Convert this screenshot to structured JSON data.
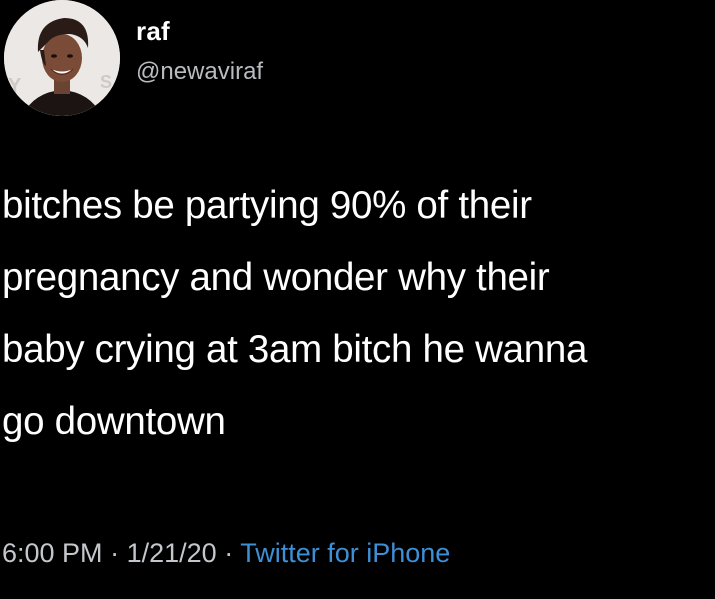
{
  "user": {
    "display_name": "raf",
    "handle": "@newaviraf"
  },
  "tweet": {
    "lines": [
      "bitches be partying 90% of their",
      "pregnancy and wonder why their",
      "baby crying at 3am bitch he wanna",
      "go downtown"
    ]
  },
  "meta": {
    "time": "6:00 PM",
    "separator": "·",
    "date": "1/21/20",
    "source": "Twitter for iPhone"
  },
  "colors": {
    "background": "#000000",
    "text": "#ffffff",
    "secondary_text": "#b8bcc1",
    "link": "#3d8fd6"
  }
}
